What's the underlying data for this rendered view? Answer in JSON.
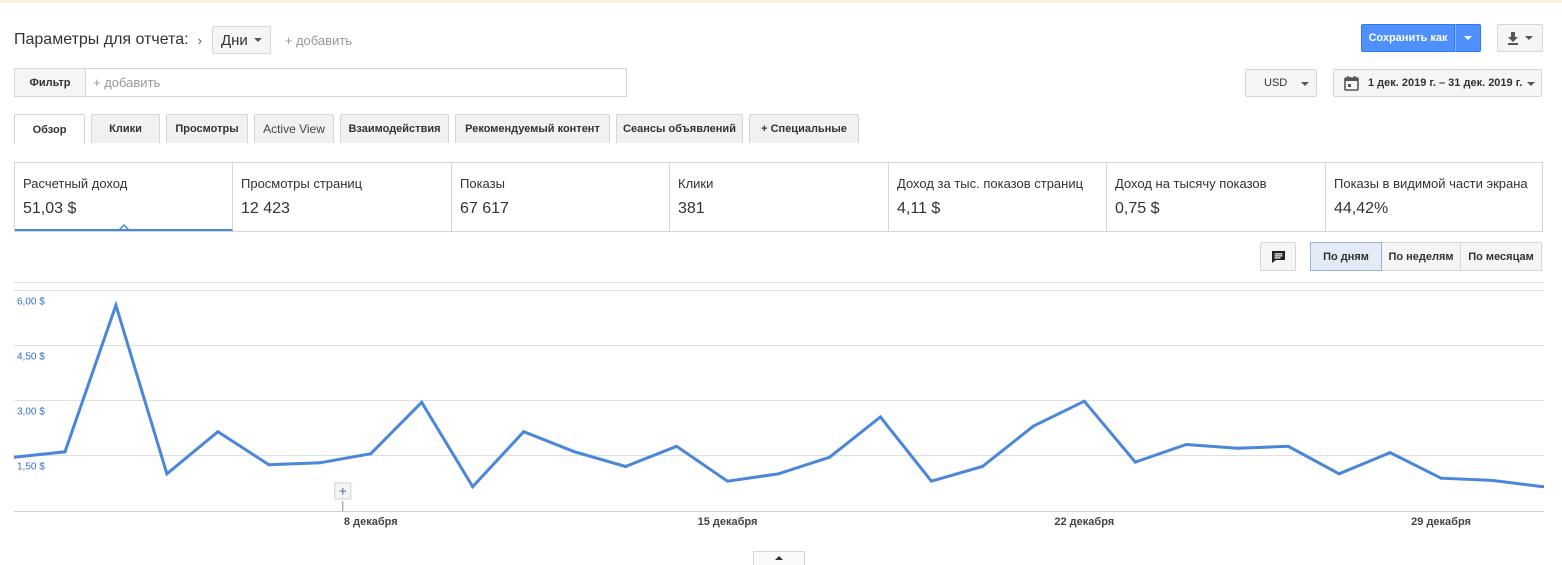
{
  "header": {
    "params_title": "Параметры для отчета:",
    "separator": "›",
    "dimension_value": "Дни",
    "add_dimension": "+ добавить",
    "save_button": "Сохранить как"
  },
  "filter": {
    "label": "Фильтр",
    "placeholder": "+ добавить"
  },
  "currency": "USD",
  "date_range": "1 дек. 2019 г. – 31 дек. 2019 г.",
  "tabs": [
    {
      "label": "Обзор"
    },
    {
      "label": "Клики"
    },
    {
      "label": "Просмотры"
    },
    {
      "label": "Active View"
    },
    {
      "label": "Взаимодействия"
    },
    {
      "label": "Рекомендуемый контент"
    },
    {
      "label": "Сеансы объявлений"
    },
    {
      "label": "+  Специальные"
    }
  ],
  "metrics": [
    {
      "name": "Расчетный доход",
      "value": "51,03 $"
    },
    {
      "name": "Просмотры страниц",
      "value": "12 423"
    },
    {
      "name": "Показы",
      "value": "67 617"
    },
    {
      "name": "Клики",
      "value": "381"
    },
    {
      "name": "Доход за тыс. показов страниц",
      "value": "4,11 $"
    },
    {
      "name": "Доход на тысячу показов",
      "value": "0,75 $"
    },
    {
      "name": "Показы в видимой части экрана",
      "value": "44,42%"
    }
  ],
  "granularity": {
    "day": "По дням",
    "week": "По неделям",
    "month": "По месяцам"
  },
  "colors": {
    "accent": "#4d90fe",
    "series": "#4a87d9",
    "axis_text": "#3b6fc4"
  },
  "chart_data": {
    "type": "line",
    "x": [
      "2019-12-01",
      "2019-12-02",
      "2019-12-03",
      "2019-12-04",
      "2019-12-05",
      "2019-12-06",
      "2019-12-07",
      "2019-12-08",
      "2019-12-09",
      "2019-12-10",
      "2019-12-11",
      "2019-12-12",
      "2019-12-13",
      "2019-12-14",
      "2019-12-15",
      "2019-12-16",
      "2019-12-17",
      "2019-12-18",
      "2019-12-19",
      "2019-12-20",
      "2019-12-21",
      "2019-12-22",
      "2019-12-23",
      "2019-12-24",
      "2019-12-25",
      "2019-12-26",
      "2019-12-27",
      "2019-12-28",
      "2019-12-29",
      "2019-12-30",
      "2019-12-31"
    ],
    "series": [
      {
        "name": "Расчетный доход",
        "values": [
          1.45,
          1.6,
          5.6,
          1.0,
          2.15,
          1.25,
          1.3,
          1.55,
          2.95,
          0.65,
          2.15,
          1.6,
          1.2,
          1.75,
          0.8,
          1.0,
          1.45,
          2.55,
          0.8,
          1.2,
          2.3,
          2.98,
          1.32,
          1.8,
          1.7,
          1.75,
          1.0,
          1.58,
          0.88,
          0.82,
          0.65
        ]
      }
    ],
    "y_ticks": [
      "1,50 $",
      "3,00 $",
      "4,50 $",
      "6,00 $"
    ],
    "y_tick_values": [
      1.5,
      3.0,
      4.5,
      6.0
    ],
    "ylim": [
      0,
      6.0
    ],
    "x_labels": [
      {
        "x": "2019-12-08",
        "label": "8 декабря"
      },
      {
        "x": "2019-12-15",
        "label": "15 декабря"
      },
      {
        "x": "2019-12-22",
        "label": "22 декабря"
      },
      {
        "x": "2019-12-29",
        "label": "29 декабря"
      }
    ],
    "annotation_marker": "+",
    "grid": true
  }
}
